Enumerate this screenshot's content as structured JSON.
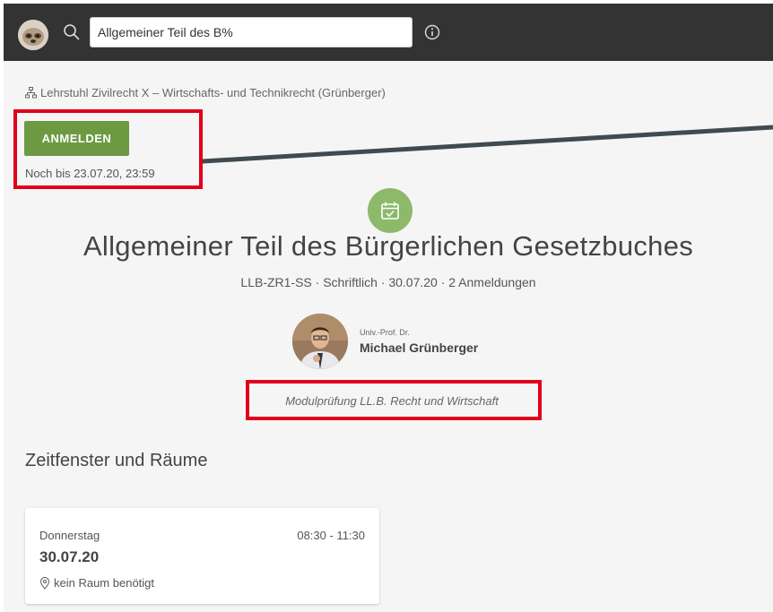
{
  "search": {
    "value": "Allgemeiner Teil des B%"
  },
  "breadcrumb": {
    "label": "Lehrstuhl Zivilrecht X – Wirtschafts- und Technikrecht (Grünberger)"
  },
  "registration": {
    "button_label": "ANMELDEN",
    "deadline": "Noch bis 23.07.20, 23:59"
  },
  "exam": {
    "title": "Allgemeiner Teil des Bürgerlichen Gesetzbuches",
    "subtitle": "LLB-ZR1-SS · Schriftlich · 30.07.20 · 2 Anmeldungen",
    "module": "Modulprüfung LL.B. Recht und Wirtschaft"
  },
  "examiner": {
    "title": "Univ.-Prof. Dr.",
    "name": "Michael Grünberger"
  },
  "timeslots": {
    "heading": "Zeitfenster und Räume",
    "items": [
      {
        "day": "Donnerstag",
        "time": "08:30 - 11:30",
        "date": "30.07.20",
        "room": "kein Raum benötigt"
      }
    ]
  },
  "icons": [
    "user-avatar",
    "search-icon",
    "info-icon",
    "org-tree-icon",
    "calendar-check-icon",
    "location-pin-icon"
  ],
  "colors": {
    "topbar": "#333333",
    "accent_green": "#6d9943",
    "icon_circle": "#8cb96a",
    "highlight_red": "#e0001a"
  }
}
